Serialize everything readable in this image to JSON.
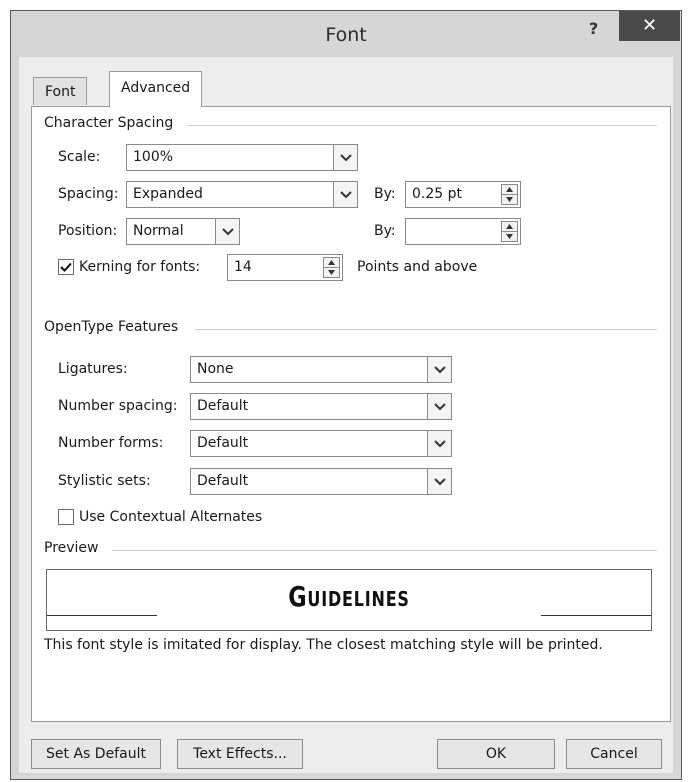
{
  "window": {
    "title": "Font",
    "help_label": "?",
    "close_label": "✕"
  },
  "tabs": [
    {
      "label": "Font",
      "active": false
    },
    {
      "label": "Advanced",
      "active": true
    }
  ],
  "character_spacing": {
    "heading": "Character Spacing",
    "scale": {
      "label": "Scale:",
      "value": "100%"
    },
    "spacing": {
      "label": "Spacing:",
      "value": "Expanded",
      "by_label": "By:",
      "by_value": "0.25 pt"
    },
    "position": {
      "label": "Position:",
      "value": "Normal",
      "by_label": "By:",
      "by_value": ""
    },
    "kerning": {
      "label": "Kerning for fonts:",
      "checked": true,
      "value": "14",
      "suffix": "Points and above"
    }
  },
  "opentype": {
    "heading": "OpenType Features",
    "ligatures": {
      "label": "Ligatures:",
      "value": "None"
    },
    "number_spacing": {
      "label": "Number spacing:",
      "value": "Default"
    },
    "number_forms": {
      "label": "Number forms:",
      "value": "Default"
    },
    "stylistic_sets": {
      "label": "Stylistic sets:",
      "value": "Default"
    },
    "contextual": {
      "label": "Use Contextual Alternates",
      "checked": false
    }
  },
  "preview": {
    "heading": "Preview",
    "sample": "Guidelines",
    "note": "This font style is imitated for display. The closest matching style will be printed."
  },
  "buttons": {
    "set_default": "Set As Default",
    "text_effects": "Text Effects...",
    "ok": "OK",
    "cancel": "Cancel"
  },
  "icons": {
    "dropdown": "chevron-down-icon",
    "spin": "spin-arrows-icon",
    "check": "checkmark-icon"
  }
}
